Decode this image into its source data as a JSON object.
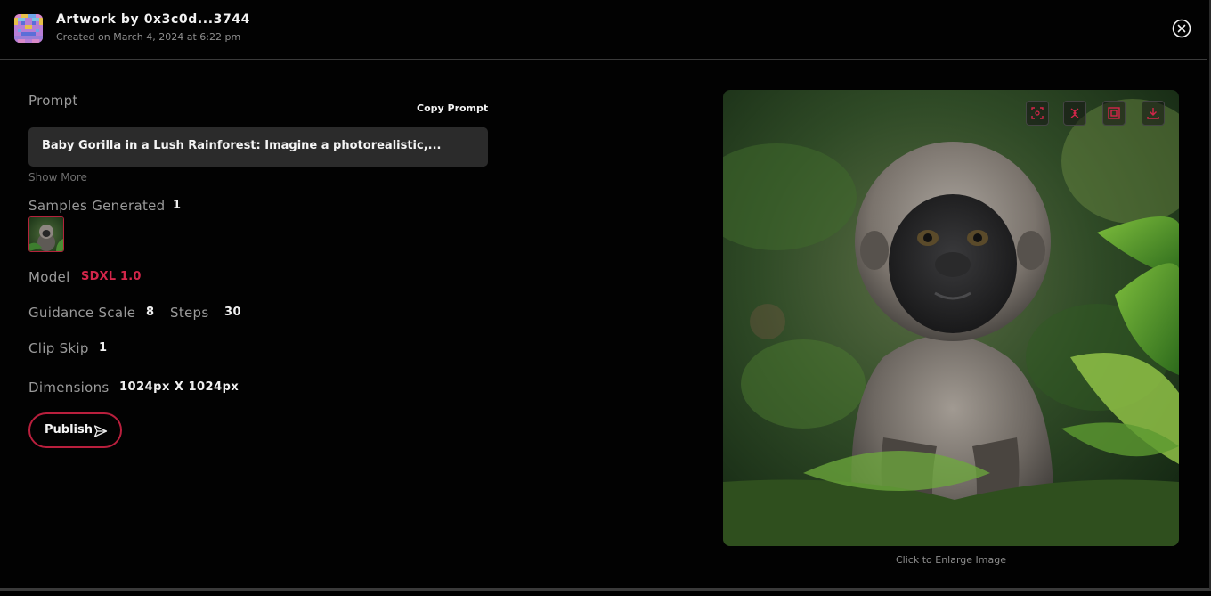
{
  "header": {
    "title": "Artwork by 0x3c0d...3744",
    "subtitle": "Created on March 4, 2024 at 6:22 pm",
    "close_icon": "close-circle-icon"
  },
  "prompt": {
    "label": "Prompt",
    "copy_label": "Copy Prompt",
    "text": "Baby Gorilla in a Lush Rainforest: Imagine a photorealistic,...",
    "show_more": "Show More"
  },
  "samples": {
    "label": "Samples Generated",
    "count": "1"
  },
  "model": {
    "label": "Model",
    "value": "SDXL 1.0"
  },
  "guidance": {
    "label": "Guidance Scale",
    "value": "8"
  },
  "steps": {
    "label": "Steps",
    "value": "30"
  },
  "clip_skip": {
    "label": "Clip Skip",
    "value": "1"
  },
  "dimensions": {
    "label": "Dimensions",
    "value": "1024px X 1024px"
  },
  "publish": {
    "label": "Publish",
    "icon": "send-icon"
  },
  "image": {
    "caption": "Click to Enlarge Image",
    "actions": [
      "scan-icon",
      "remix-icon",
      "frame-icon",
      "download-icon"
    ]
  },
  "colors": {
    "accent": "#d3264a",
    "background": "#020202",
    "panel": "#2b2b2b"
  }
}
